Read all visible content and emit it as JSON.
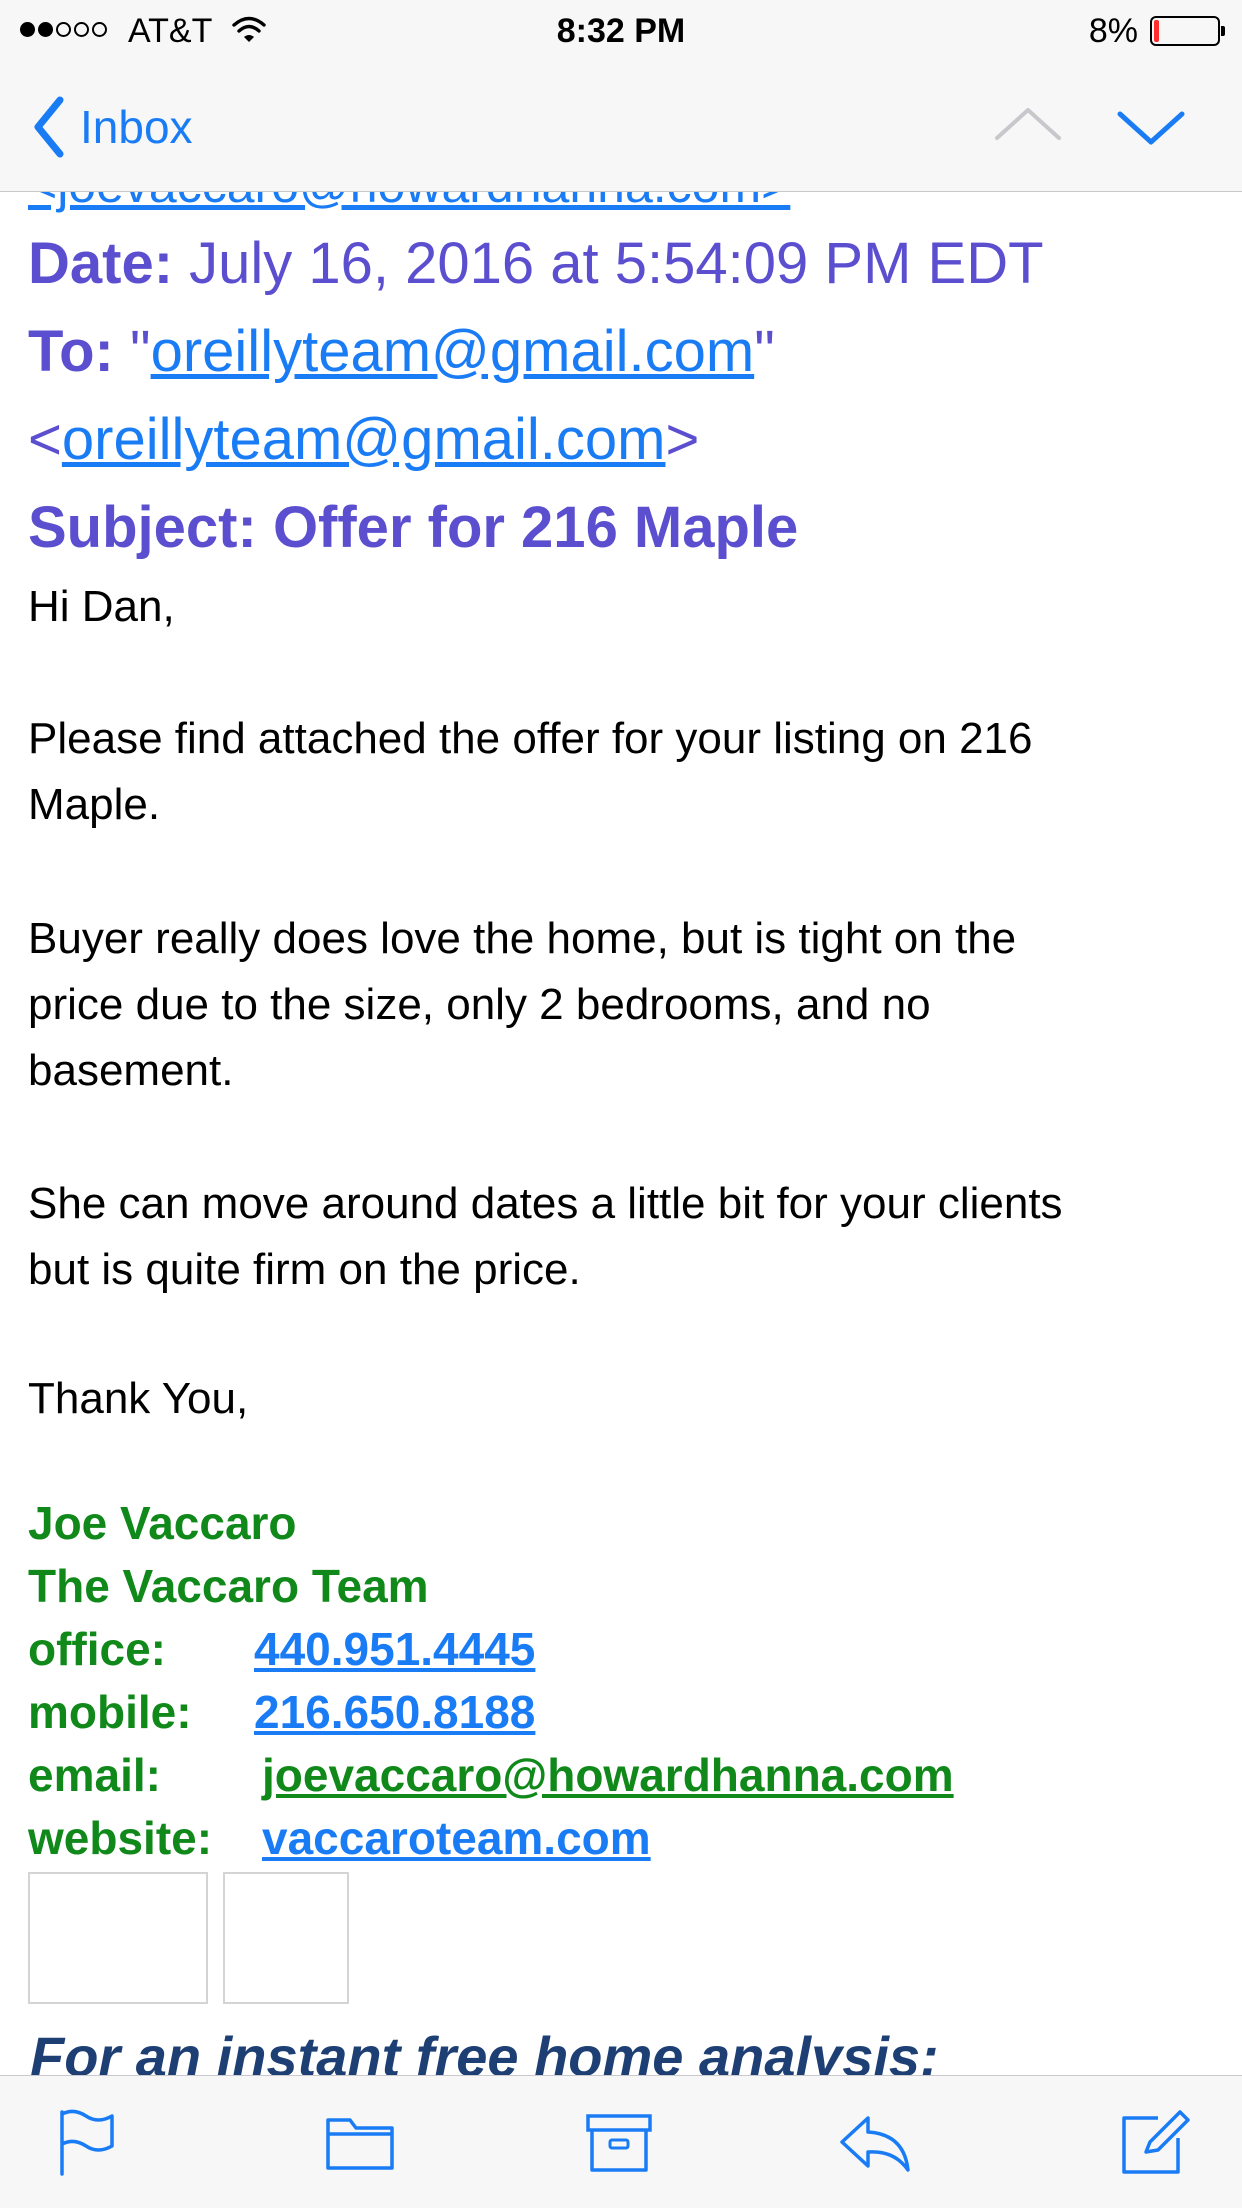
{
  "status_bar": {
    "carrier": "AT&T",
    "time": "8:32 PM",
    "battery_percent": "8%",
    "battery_level": 0.08,
    "signal_bars": 2,
    "signal_total": 5
  },
  "nav": {
    "back_label": "Inbox",
    "back_icon": "chevron-left-icon",
    "prev_icon": "chevron-up-icon",
    "next_icon": "chevron-down-icon"
  },
  "email": {
    "cut_from_line": "<joevaccaro@howardhanna.com>",
    "date_label": "Date:",
    "date_value": "July 16, 2016 at 5:54:09 PM EDT",
    "to_label": "To:",
    "to_quote_open": "\"",
    "to_name": "oreillyteam@gmail.com",
    "to_quote_close": "\"",
    "to_angle_open": "<",
    "to_address": "oreillyteam@gmail.com",
    "to_angle_close": ">",
    "subject_label": "Subject:",
    "subject_value": "Offer for 216 Maple",
    "body": [
      "Hi Dan,",
      "Please find attached the offer for your listing on 216",
      "Maple.",
      "Buyer really does love the home, but is tight on the",
      "price due to the size, only 2 bedrooms, and no",
      "basement.",
      "She can move around dates a little bit for your clients",
      "but is quite firm on the price.",
      "Thank You,"
    ]
  },
  "signature": {
    "name": "Joe Vaccaro",
    "team": "The Vaccaro Team",
    "office_label": "office:",
    "office_value": "440.951.4445",
    "mobile_label": "mobile:",
    "mobile_value": "216.650.8188",
    "email_label": "email:",
    "email_value": "joevaccaro@howardhanna.com",
    "website_label": "website:",
    "website_value": "vaccaroteam.com"
  },
  "promo_text": "For an instant free home analysis:",
  "toolbar": {
    "icons": [
      "flag-icon",
      "folder-icon",
      "archive-icon",
      "reply-icon",
      "compose-icon"
    ]
  },
  "colors": {
    "ios_blue": "#1a7cf5",
    "header_purple": "#5b4fd0",
    "signature_green": "#10891a",
    "promo_navy": "#1d3f74",
    "battery_red": "#ff2d2d"
  }
}
